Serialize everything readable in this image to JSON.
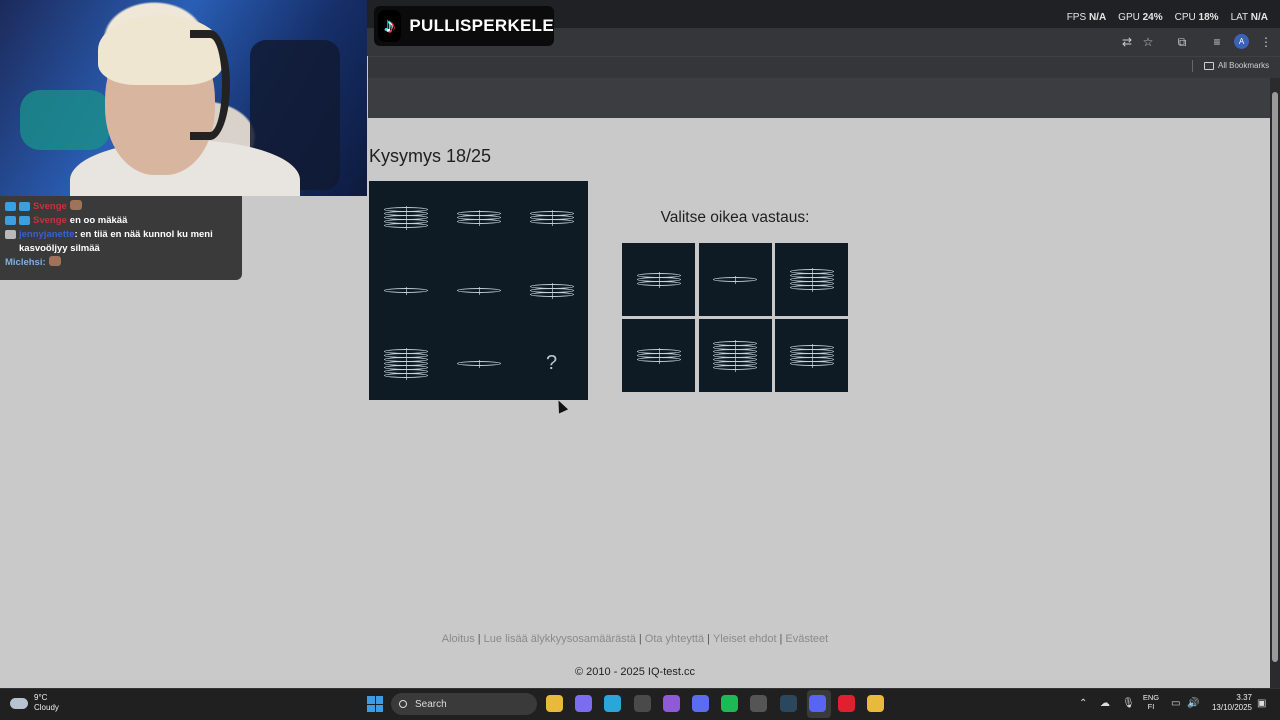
{
  "overlay": {
    "channel_name": "PULLISPERKELE",
    "stats": [
      {
        "label": "FPS",
        "value": "N/A"
      },
      {
        "label": "GPU",
        "value": "24%"
      },
      {
        "label": "CPU",
        "value": "18%"
      },
      {
        "label": "LAT",
        "value": "N/A"
      }
    ],
    "chat": [
      {
        "user": "Svenge",
        "user_color": "#c8323c",
        "message": ""
      },
      {
        "user": "Svenge",
        "user_color": "#c8323c",
        "message": "en oo mäkää"
      },
      {
        "user": "jennyjanette",
        "user_color": "#3a5fcf",
        "message": "en tiiä en nää kunnol ku meni kasvoöljyy silmää"
      },
      {
        "user": "Miclehsi:",
        "user_color": "#7fb0e0",
        "message": ""
      }
    ]
  },
  "browser": {
    "bookmarks_label": "All Bookmarks",
    "account_initial": "A"
  },
  "quiz": {
    "title": "Kysymys 18/25",
    "instruction": "Valitse oikea vastaus:",
    "missing_symbol": "?",
    "matrix": [
      {
        "rings": 5,
        "width": 44
      },
      {
        "rings": 3,
        "width": 44
      },
      {
        "rings": 3,
        "width": 44
      },
      {
        "rings": 1,
        "width": 44
      },
      {
        "rings": 1,
        "width": 44
      },
      {
        "rings": 3,
        "width": 44
      },
      {
        "rings": 7,
        "width": 44
      },
      {
        "rings": 1,
        "width": 44
      },
      null
    ],
    "answers": [
      {
        "rings": 3,
        "width": 44
      },
      {
        "rings": 1,
        "width": 44
      },
      {
        "rings": 5,
        "width": 44
      },
      {
        "rings": 3,
        "width": 44
      },
      {
        "rings": 7,
        "width": 44
      },
      {
        "rings": 5,
        "width": 44
      }
    ]
  },
  "footer": {
    "links": [
      "Aloitus",
      "Lue lisää älykkyysosamäärästä",
      "Ota yhteyttä",
      "Yleiset ehdot",
      "Evästeet"
    ],
    "copyright": "© 2010 - 2025 IQ-test.cc"
  },
  "taskbar": {
    "weather_temp": "9°C",
    "weather_desc": "Cloudy",
    "search_placeholder": "Search",
    "lang_top": "ENG",
    "lang_bottom": "FI",
    "time": "3.37",
    "date": "13/10/2025",
    "apps": [
      {
        "name": "file-explorer-icon",
        "color": "#e8b93a"
      },
      {
        "name": "copilot-icon",
        "color": "#7c6cf0"
      },
      {
        "name": "edge-icon",
        "color": "#2aa7d8"
      },
      {
        "name": "store-icon",
        "color": "#4a4a4a"
      },
      {
        "name": "media-icon",
        "color": "#8e5ad8"
      },
      {
        "name": "arc-icon",
        "color": "#5a6df0"
      },
      {
        "name": "spotify-icon",
        "color": "#1db954"
      },
      {
        "name": "obs-icon",
        "color": "#555555"
      },
      {
        "name": "steam-icon",
        "color": "#2a475e"
      },
      {
        "name": "discord-icon",
        "color": "#5865f2"
      },
      {
        "name": "opera-icon",
        "color": "#e0202e"
      },
      {
        "name": "chrome-icon",
        "color": "#e8b93a"
      }
    ]
  }
}
